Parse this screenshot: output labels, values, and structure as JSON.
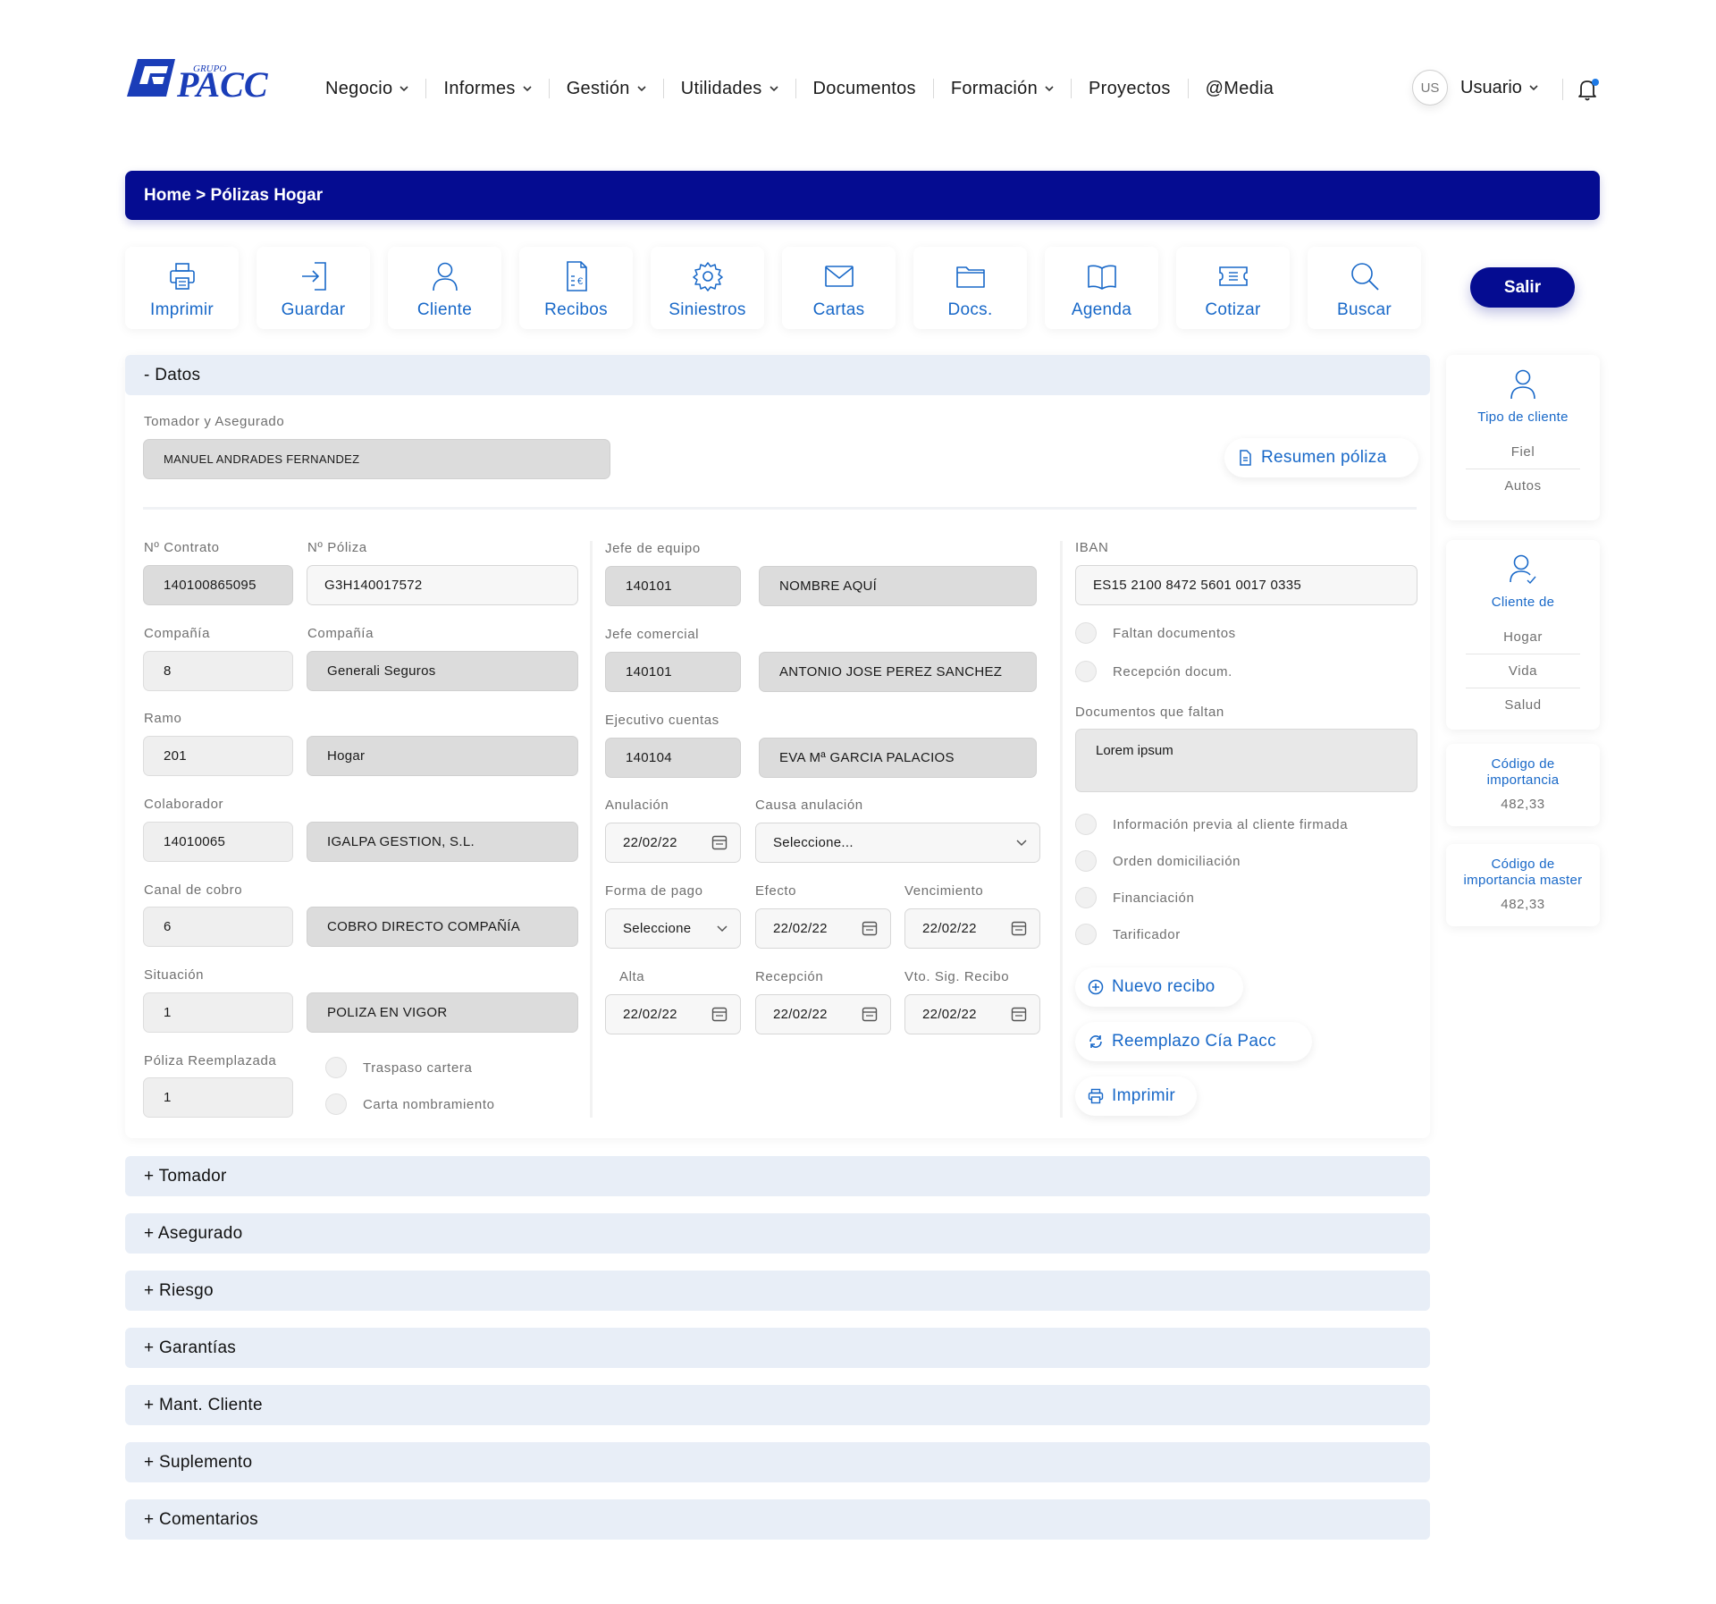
{
  "brand": {
    "logo_small": "GRUPO",
    "logo_main": "PACC",
    "color": "#1a3db8"
  },
  "nav": {
    "items": [
      {
        "label": "Negocio",
        "dropdown": true
      },
      {
        "label": "Informes",
        "dropdown": true
      },
      {
        "label": "Gestión",
        "dropdown": true
      },
      {
        "label": "Utilidades",
        "dropdown": true
      },
      {
        "label": "Documentos",
        "dropdown": false
      },
      {
        "label": "Formación",
        "dropdown": true
      },
      {
        "label": "Proyectos",
        "dropdown": false
      },
      {
        "label": "@Media",
        "dropdown": false
      }
    ]
  },
  "user": {
    "initials": "US",
    "name": "Usuario",
    "notification_icon": "bell-icon"
  },
  "breadcrumb": {
    "text": "Home > Pólizas Hogar"
  },
  "colors": {
    "primary": "#050c91",
    "accent": "#1868c8",
    "section_bg": "#e8eef7"
  },
  "toolbar": {
    "items": [
      {
        "label": "Imprimir",
        "icon": "printer-icon"
      },
      {
        "label": "Guardar",
        "icon": "login-icon"
      },
      {
        "label": "Cliente",
        "icon": "user-icon"
      },
      {
        "label": "Recibos",
        "icon": "receipt-icon"
      },
      {
        "label": "Siniestros",
        "icon": "gear-icon"
      },
      {
        "label": "Cartas",
        "icon": "envelope-icon"
      },
      {
        "label": "Docs.",
        "icon": "folder-icon"
      },
      {
        "label": "Agenda",
        "icon": "book-icon"
      },
      {
        "label": "Cotizar",
        "icon": "ticket-icon"
      },
      {
        "label": "Buscar",
        "icon": "search-icon"
      }
    ],
    "exit_label": "Salir"
  },
  "datos": {
    "header": "- Datos",
    "tomador_label": "Tomador y Asegurado",
    "tomador_value": "MANUEL ANDRADES FERNANDEZ",
    "resumen_label": "Resumen póliza",
    "contrato_label": "Nº Contrato",
    "contrato_value": "140100865095",
    "poliza_label": "Nº Póliza",
    "poliza_value": "G3H140017572",
    "compania_label": "Compañía",
    "compania_code": "8",
    "compania_label2": "Compañía",
    "compania_name": "Generali Seguros",
    "ramo_label": "Ramo",
    "ramo_code": "201",
    "ramo_name": "Hogar",
    "colaborador_label": "Colaborador",
    "colaborador_code": "14010065",
    "colaborador_name": "IGALPA GESTION, S.L.",
    "canal_label": "Canal de cobro",
    "canal_code": "6",
    "canal_name": "COBRO DIRECTO COMPAÑÍA",
    "situacion_label": "Situación",
    "situacion_code": "1",
    "situacion_name": "POLIZA EN VIGOR",
    "reemplazada_label": "Póliza Reemplazada",
    "reemplazada_value": "1",
    "traspaso_label": "Traspaso cartera",
    "carta_label": "Carta nombramiento",
    "jefe_equipo_label": "Jefe de equipo",
    "jefe_equipo_code": "140101",
    "jefe_equipo_name": "NOMBRE AQUÍ",
    "jefe_comercial_label": "Jefe comercial",
    "jefe_comercial_code": "140101",
    "jefe_comercial_name": "ANTONIO JOSE PEREZ SANCHEZ",
    "ejecutivo_label": "Ejecutivo cuentas",
    "ejecutivo_code": "140104",
    "ejecutivo_name": "EVA Mª GARCIA PALACIOS",
    "anulacion_label": "Anulación",
    "anulacion_value": "22/02/22",
    "causa_label": "Causa anulación",
    "causa_value": "Seleccione...",
    "forma_pago_label": "Forma de pago",
    "forma_pago_value": "Seleccione",
    "efecto_label": "Efecto",
    "efecto_value": "22/02/22",
    "vencimiento_label": "Vencimiento",
    "vencimiento_value": "22/02/22",
    "alta_label": "Alta",
    "alta_value": "22/02/22",
    "recepcion_label": "Recepción",
    "recepcion_value": "22/02/22",
    "vto_label": "Vto. Sig. Recibo",
    "vto_value": "22/02/22",
    "iban_label": "IBAN",
    "iban_value": "ES15 2100 8472 5601 0017 0335",
    "faltan_docs_label": "Faltan documentos",
    "recepcion_docs_label": "Recepción docum.",
    "docs_faltan_label": "Documentos que faltan",
    "docs_faltan_value": "Lorem ipsum",
    "info_previa_label": "Información previa al cliente firmada",
    "orden_label": "Orden domiciliación",
    "financiacion_label": "Financiación",
    "tarificador_label": "Tarificador",
    "nuevo_recibo_label": "Nuevo recibo",
    "reemplazo_label": "Reemplazo Cía Pacc",
    "imprimir_label": "Imprimir"
  },
  "sections": [
    {
      "label": "+ Tomador"
    },
    {
      "label": "+ Asegurado"
    },
    {
      "label": "+ Riesgo"
    },
    {
      "label": "+ Garantías"
    },
    {
      "label": "+ Mant. Cliente"
    },
    {
      "label": "+ Suplemento"
    },
    {
      "label": "+ Comentarios"
    }
  ],
  "side": {
    "tipo_cliente": {
      "title": "Tipo de cliente",
      "values": [
        "Fiel",
        "Autos"
      ]
    },
    "cliente_de": {
      "title": "Cliente de",
      "values": [
        "Hogar",
        "Vida",
        "Salud"
      ]
    },
    "codigo": {
      "title": "Código de importancia",
      "value": "482,33"
    },
    "codigo_master": {
      "title": "Código de importancia master",
      "value": "482,33"
    }
  }
}
